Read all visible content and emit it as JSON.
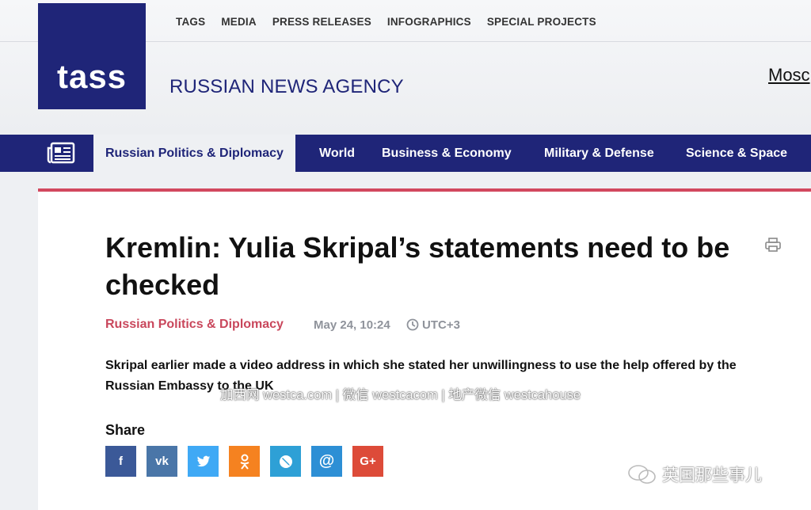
{
  "header": {
    "top_links": [
      "TAGS",
      "MEDIA",
      "PRESS RELEASES",
      "INFOGRAPHICS",
      "SPECIAL PROJECTS"
    ],
    "logo_text": "tass",
    "agency_name": "RUSSIAN NEWS AGENCY",
    "city_partial": "Mosc"
  },
  "nav": {
    "items": [
      {
        "label": "Russian Politics & Diplomacy",
        "active": true
      },
      {
        "label": "World",
        "active": false
      },
      {
        "label": "Business & Economy",
        "active": false
      },
      {
        "label": "Military & Defense",
        "active": false
      },
      {
        "label": "Science & Space",
        "active": false
      }
    ],
    "menu_icon": "newspaper-menu-icon"
  },
  "article": {
    "title": "Kremlin: Yulia Skripal’s statements need to be checked",
    "category": "Russian Politics & Diplomacy",
    "date": "May 24, 10:24",
    "timezone": "UTC+3",
    "lead": "Skripal earlier made a video address in which she stated her unwillingness to use the help offered by the Russian Embassy to the UK"
  },
  "share": {
    "label": "Share",
    "buttons": [
      {
        "name": "facebook",
        "glyph": "f",
        "color": "#3b5998"
      },
      {
        "name": "vk",
        "glyph": "vk",
        "color": "#4a76a8"
      },
      {
        "name": "twitter",
        "glyph": "🐦",
        "color": "#3fa9f5"
      },
      {
        "name": "odnoklassniki",
        "glyph": "ok",
        "color": "#f58220"
      },
      {
        "name": "livejournal",
        "glyph": "✎",
        "color": "#2ea0d6"
      },
      {
        "name": "email",
        "glyph": "@",
        "color": "#2d8fd5"
      },
      {
        "name": "google-plus",
        "glyph": "G+",
        "color": "#dd4b39"
      }
    ]
  },
  "overlays": {
    "watermark": "加西网 westca.com | 微信 westcacom | 地产微信 westcahouse",
    "corner": "英国那些事儿"
  },
  "colors": {
    "brand": "#1f2578",
    "accent": "#d2485e",
    "meta_gray": "#8f939b"
  }
}
